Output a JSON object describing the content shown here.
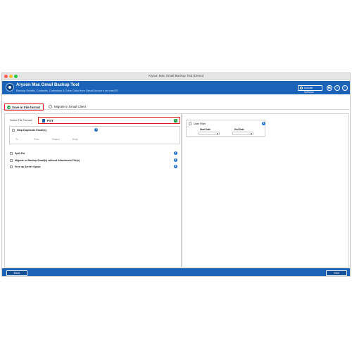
{
  "window": {
    "title": "Aryson Mac Gmail Backup Tool (Demo)"
  },
  "header": {
    "app_title": "Aryson Mac Gmail Backup Tool",
    "app_subtitle": "Backup Emails, Contacts, Calendars & Drive Data from Gmail Account on macOS",
    "activate_label": "Activate Software",
    "buttons": [
      {
        "icon": "cart-icon",
        "glyph": "⛟"
      },
      {
        "icon": "help-icon",
        "glyph": "?"
      },
      {
        "icon": "info-icon",
        "glyph": "i"
      }
    ],
    "accent_color": "#1b63b8"
  },
  "tabs": {
    "save_label": "Save in File format",
    "migrate_label": "Migrate in Email Client",
    "selected": "save"
  },
  "left": {
    "format_label": "Select File Format :",
    "format_value": "PST",
    "skip": {
      "label": "Skip Duplicate Email(s)",
      "fields": [
        "To",
        "From",
        "Subject",
        "Body"
      ]
    },
    "options": [
      {
        "label": "Split Pst"
      },
      {
        "label": "Migrate or Backup Email(s) without Attachment File(s)"
      },
      {
        "label": "Free up Server Space"
      }
    ]
  },
  "right": {
    "date_filter_label": "Date Filter",
    "start_label": "Start Date",
    "end_label": "End Date"
  },
  "footer": {
    "back_label": "Back",
    "next_label": "Next"
  },
  "colors": {
    "highlight": "#e0161b",
    "selected_radio": "#24a04a"
  }
}
